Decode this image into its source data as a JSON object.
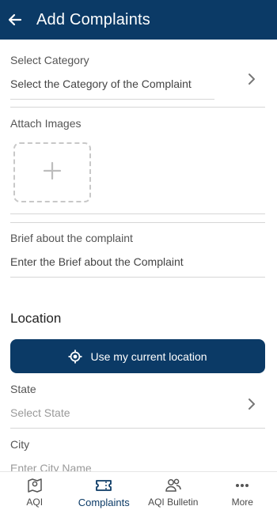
{
  "header": {
    "title": "Add Complaints",
    "back_icon": "arrow-left-icon"
  },
  "form": {
    "category": {
      "label": "Select Category",
      "placeholder": "Select the Category of the Complaint"
    },
    "attach": {
      "label": "Attach Images",
      "add_icon": "plus-icon"
    },
    "brief": {
      "label": "Brief about the complaint",
      "placeholder": "Enter the Brief about the Complaint"
    }
  },
  "location": {
    "title": "Location",
    "button_label": "Use my current location",
    "state": {
      "label": "State",
      "placeholder": "Select State"
    },
    "city": {
      "label": "City",
      "placeholder": "Enter City Name"
    }
  },
  "bottom_nav": [
    {
      "label": "AQI",
      "icon": "map-pin-icon"
    },
    {
      "label": "Complaints",
      "icon": "ticket-icon",
      "active": true
    },
    {
      "label": "AQI Bulletin",
      "icon": "users-icon"
    },
    {
      "label": "More",
      "icon": "more-dots-icon"
    }
  ],
  "colors": {
    "primary": "#0b3a66",
    "divider": "#d6d6d6"
  }
}
